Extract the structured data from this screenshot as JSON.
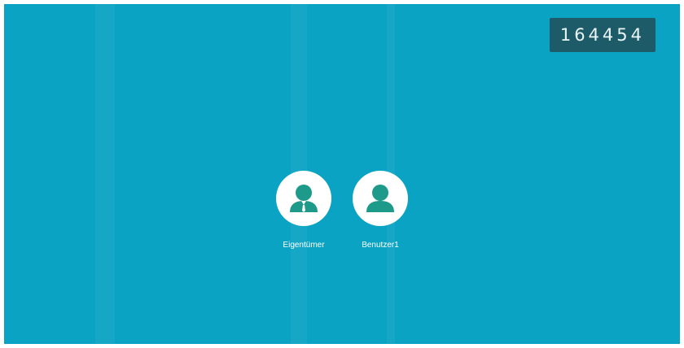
{
  "pairing_code": "164454",
  "users": [
    {
      "label": "Eigentümer",
      "icon": "owner-avatar-icon"
    },
    {
      "label": "Benutzer1",
      "icon": "user-avatar-icon"
    }
  ],
  "colors": {
    "background": "#0aa3c4",
    "code_box": "#1e5b68",
    "avatar_bg": "#ffffff",
    "avatar_figure": "#1e9a8a"
  }
}
